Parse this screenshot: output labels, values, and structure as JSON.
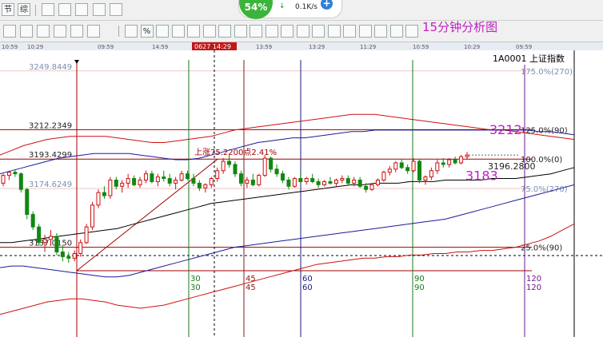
{
  "toolbar_top": {
    "buttons": [
      "节",
      "综",
      "",
      "",
      "",
      "",
      ""
    ],
    "speed": {
      "percent": "54%",
      "rate": "0.1K/s",
      "arrow": "↓",
      "plus": "+"
    }
  },
  "toolbar_draw": {
    "buttons": [
      "",
      "",
      "",
      "",
      "",
      "",
      "",
      "%",
      "",
      "",
      "",
      "",
      "",
      "",
      "",
      "",
      "",
      "",
      "",
      "",
      "",
      "",
      "",
      "",
      ""
    ]
  },
  "analysis_title": "15分钟分析图",
  "index_label": "1A0001 上证指数",
  "date_axis": {
    "labels": [
      "10:59",
      "10:29",
      "09:59",
      "14:59",
      "14:29",
      "13:59",
      "13:29",
      "11:29",
      "10:59",
      "10:29",
      "09:59"
    ],
    "highlight": "0627 14:29"
  },
  "colors": {
    "up_candle": "#cc1111",
    "down_candle": "#118811",
    "ma_red": "#cc1111",
    "ma_black": "#000000",
    "ma_blue": "#1a1a9a",
    "grid_ruler": "#a00000",
    "fib_label": "#7a8fb0",
    "accent_magenta": "#c020c0",
    "cycle_green": "#1a7a1a",
    "cycle_red": "#8a1a1a",
    "cycle_navy": "#1a1a7a",
    "cycle_purple": "#6a1a8a"
  },
  "chart_data": {
    "type": "candlestick",
    "y_axis": {
      "ylim": [
        3122,
        3262
      ]
    },
    "price_levels": [
      {
        "label": "3249.8449",
        "value": 3249.8449,
        "right_label": "175.0%(270)"
      },
      {
        "label": "3212.2349",
        "value": 3212.2349,
        "right_label": "125.0%(90)"
      },
      {
        "label": "3193.4299",
        "value": 3193.4299,
        "right_label": "100.0%(0)"
      },
      {
        "label": "3174.6249",
        "value": 3174.6249,
        "right_label": "75.0%(270)"
      },
      {
        "label": "3137.0150",
        "value": 3137.015,
        "right_label": "25.0%(90)"
      }
    ],
    "rise_annotation": "上涨75.2200点2.41%",
    "current_value_label": "3196.2800",
    "hand_notes": [
      {
        "text": "3212",
        "value": 3212
      },
      {
        "text": "3183",
        "value": 3183
      }
    ],
    "cycle_lines": [
      {
        "labels": [
          "30",
          "30"
        ],
        "color": "green"
      },
      {
        "labels": [
          "45",
          "45"
        ],
        "color": "red"
      },
      {
        "labels": [
          "60",
          "60"
        ],
        "color": "navy"
      },
      {
        "labels": [
          "90",
          "90"
        ],
        "color": "green"
      },
      {
        "labels": [
          "120",
          "120"
        ],
        "color": "purple"
      }
    ],
    "candles": [
      [
        3178,
        3184,
        3176,
        3183
      ],
      [
        3183,
        3186,
        3180,
        3185
      ],
      [
        3185,
        3187,
        3182,
        3184
      ],
      [
        3184,
        3185,
        3172,
        3174
      ],
      [
        3174,
        3175,
        3155,
        3158
      ],
      [
        3158,
        3160,
        3148,
        3150
      ],
      [
        3150,
        3152,
        3138,
        3140
      ],
      [
        3140,
        3145,
        3134,
        3142
      ],
      [
        3142,
        3148,
        3138,
        3144
      ],
      [
        3144,
        3146,
        3132,
        3134
      ],
      [
        3134,
        3138,
        3128,
        3131
      ],
      [
        3131,
        3134,
        3127,
        3130
      ],
      [
        3130,
        3135,
        3128,
        3133
      ],
      [
        3133,
        3142,
        3131,
        3140
      ],
      [
        3140,
        3152,
        3139,
        3150
      ],
      [
        3150,
        3166,
        3148,
        3164
      ],
      [
        3164,
        3174,
        3162,
        3172
      ],
      [
        3172,
        3176,
        3168,
        3170
      ],
      [
        3170,
        3182,
        3168,
        3180
      ],
      [
        3180,
        3182,
        3174,
        3176
      ],
      [
        3176,
        3180,
        3172,
        3178
      ],
      [
        3178,
        3184,
        3175,
        3181
      ],
      [
        3181,
        3183,
        3176,
        3177
      ],
      [
        3177,
        3182,
        3175,
        3180
      ],
      [
        3180,
        3186,
        3178,
        3184
      ],
      [
        3184,
        3186,
        3178,
        3179
      ],
      [
        3179,
        3184,
        3176,
        3182
      ],
      [
        3182,
        3186,
        3179,
        3181
      ],
      [
        3181,
        3184,
        3176,
        3178
      ],
      [
        3178,
        3182,
        3174,
        3180
      ],
      [
        3180,
        3186,
        3179,
        3184
      ],
      [
        3184,
        3186,
        3180,
        3181
      ],
      [
        3181,
        3184,
        3176,
        3178
      ],
      [
        3178,
        3180,
        3173,
        3175
      ],
      [
        3175,
        3178,
        3172,
        3177
      ],
      [
        3177,
        3182,
        3175,
        3181
      ],
      [
        3181,
        3188,
        3179,
        3186
      ],
      [
        3186,
        3194,
        3184,
        3192
      ],
      [
        3192,
        3196,
        3188,
        3190
      ],
      [
        3190,
        3192,
        3182,
        3184
      ],
      [
        3184,
        3186,
        3176,
        3178
      ],
      [
        3178,
        3182,
        3175,
        3180
      ],
      [
        3180,
        3184,
        3176,
        3177
      ],
      [
        3177,
        3184,
        3176,
        3183
      ],
      [
        3183,
        3196,
        3182,
        3194
      ],
      [
        3194,
        3195,
        3185,
        3187
      ],
      [
        3187,
        3190,
        3182,
        3184
      ],
      [
        3184,
        3186,
        3178,
        3180
      ],
      [
        3180,
        3182,
        3174,
        3176
      ],
      [
        3176,
        3182,
        3175,
        3181
      ],
      [
        3181,
        3185,
        3178,
        3179
      ],
      [
        3179,
        3182,
        3177,
        3181
      ],
      [
        3181,
        3184,
        3178,
        3179
      ],
      [
        3179,
        3181,
        3175,
        3177
      ],
      [
        3177,
        3180,
        3176,
        3179
      ],
      [
        3179,
        3182,
        3177,
        3178
      ],
      [
        3178,
        3181,
        3176,
        3180
      ],
      [
        3180,
        3183,
        3178,
        3181
      ],
      [
        3181,
        3183,
        3177,
        3178
      ],
      [
        3178,
        3182,
        3176,
        3180
      ],
      [
        3180,
        3182,
        3175,
        3176
      ],
      [
        3176,
        3178,
        3172,
        3174
      ],
      [
        3174,
        3178,
        3173,
        3177
      ],
      [
        3177,
        3181,
        3176,
        3180
      ],
      [
        3180,
        3186,
        3179,
        3185
      ],
      [
        3185,
        3189,
        3183,
        3187
      ],
      [
        3187,
        3192,
        3185,
        3191
      ],
      [
        3191,
        3193,
        3187,
        3188
      ],
      [
        3188,
        3190,
        3184,
        3186
      ],
      [
        3186,
        3194,
        3185,
        3192
      ],
      [
        3192,
        3193,
        3178,
        3180
      ],
      [
        3180,
        3183,
        3177,
        3182
      ],
      [
        3182,
        3188,
        3180,
        3186
      ],
      [
        3186,
        3193,
        3184,
        3191
      ],
      [
        3191,
        3194,
        3188,
        3190
      ],
      [
        3190,
        3194,
        3188,
        3193
      ],
      [
        3193,
        3195,
        3190,
        3191
      ],
      [
        3191,
        3196,
        3190,
        3195
      ],
      [
        3195,
        3198,
        3193,
        3196
      ]
    ],
    "ma_red": [
      3196,
      3199,
      3202,
      3204,
      3206,
      3207,
      3208,
      3208,
      3208,
      3208,
      3207,
      3206,
      3205,
      3204,
      3204,
      3205,
      3206,
      3207,
      3208,
      3210,
      3212,
      3213,
      3214,
      3215,
      3216,
      3217,
      3218,
      3219,
      3220,
      3221,
      3222,
      3222,
      3222,
      3221,
      3220,
      3219,
      3218,
      3217,
      3216,
      3215,
      3214,
      3213,
      3212,
      3212,
      3211,
      3210,
      3209,
      3208,
      3207,
      3206
    ],
    "ma_black": [
      3140,
      3140,
      3141,
      3142,
      3143,
      3144,
      3145,
      3146,
      3147,
      3148,
      3149,
      3151,
      3153,
      3155,
      3157,
      3159,
      3161,
      3163,
      3165,
      3166,
      3167,
      3168,
      3169,
      3170,
      3171,
      3172,
      3173,
      3174,
      3175,
      3176,
      3177,
      3177,
      3178,
      3178,
      3178,
      3179,
      3179,
      3179,
      3180,
      3180,
      3180,
      3180,
      3181,
      3181,
      3181,
      3182,
      3183,
      3184,
      3186,
      3188
    ],
    "ma_blue": [
      3184,
      3186,
      3188,
      3190,
      3192,
      3194,
      3195,
      3196,
      3197,
      3197,
      3197,
      3197,
      3196,
      3195,
      3194,
      3193,
      3193,
      3194,
      3196,
      3198,
      3200,
      3202,
      3204,
      3205,
      3206,
      3207,
      3207,
      3208,
      3209,
      3210,
      3211,
      3211,
      3212,
      3212,
      3212,
      3212,
      3212,
      3212,
      3212,
      3212,
      3212,
      3212,
      3212,
      3212,
      3212,
      3212,
      3211,
      3211,
      3210,
      3209
    ],
    "ma_navy": [
      3124,
      3125,
      3125,
      3124,
      3123,
      3122,
      3121,
      3120,
      3119,
      3118,
      3118,
      3119,
      3121,
      3123,
      3125,
      3127,
      3129,
      3131,
      3133,
      3135,
      3137,
      3138,
      3139,
      3140,
      3141,
      3142,
      3143,
      3144,
      3145,
      3146,
      3147,
      3148,
      3149,
      3150,
      3151,
      3152,
      3153,
      3154,
      3155,
      3157,
      3159,
      3161,
      3163,
      3165,
      3167,
      3169,
      3171,
      3173,
      3175,
      3177
    ],
    "ma_red_low": [
      3094,
      3096,
      3098,
      3100,
      3102,
      3103,
      3104,
      3104,
      3103,
      3102,
      3100,
      3099,
      3098,
      3099,
      3100,
      3102,
      3104,
      3106,
      3108,
      3110,
      3112,
      3114,
      3116,
      3118,
      3120,
      3122,
      3124,
      3126,
      3127,
      3128,
      3129,
      3130,
      3130,
      3131,
      3131,
      3132,
      3132,
      3133,
      3133,
      3134,
      3134,
      3135,
      3135,
      3136,
      3137,
      3139,
      3141,
      3144,
      3148,
      3152
    ]
  }
}
